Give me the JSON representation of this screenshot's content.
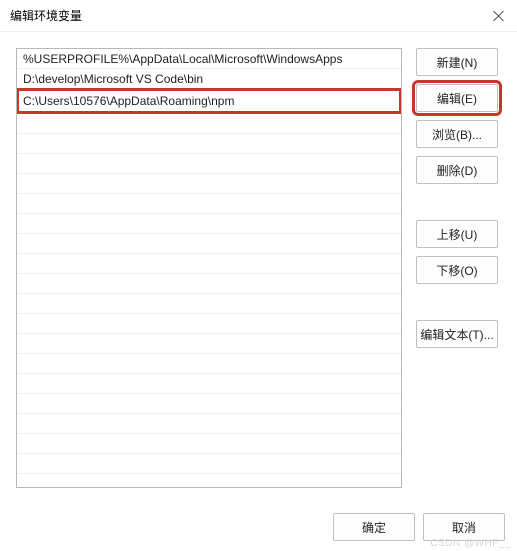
{
  "title": "编辑环境变量",
  "list": {
    "items": [
      "%USERPROFILE%\\AppData\\Local\\Microsoft\\WindowsApps",
      "D:\\develop\\Microsoft VS Code\\bin",
      "C:\\Users\\10576\\AppData\\Roaming\\npm"
    ],
    "highlighted_index": 2
  },
  "buttons": {
    "new": "新建(N)",
    "edit": "编辑(E)",
    "browse": "浏览(B)...",
    "delete": "删除(D)",
    "move_up": "上移(U)",
    "move_down": "下移(O)",
    "edit_text": "编辑文本(T)...",
    "ok": "确定",
    "cancel": "取消"
  },
  "watermark": "CSDN @WHF__"
}
